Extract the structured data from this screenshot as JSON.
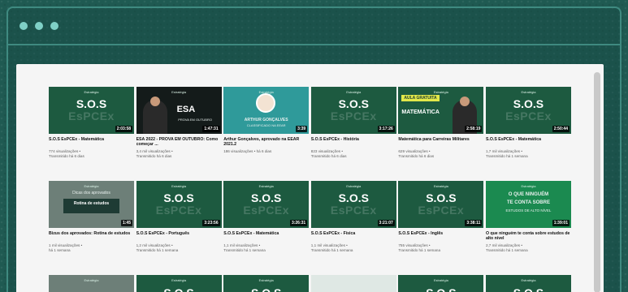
{
  "colors": {
    "background": "#1f5a52",
    "frame": "#3f8a80",
    "panel": "#f5f5f5",
    "thumb_green": "#1d5a40"
  },
  "videos": [
    {
      "style": "sos",
      "brand": "Estratégia",
      "sos": "S.O.S",
      "espcex": "EsPCEx",
      "duration": "2:03:58",
      "title": "S.O.S EsPCEx - Matemática",
      "meta1": "774 visualizações •",
      "meta2": "Transmitido há 6 dias"
    },
    {
      "style": "esa",
      "brand": "Estratégia",
      "big": "ESA",
      "sub": "PROVA EM OUTUBRO",
      "duration": "1:47:31",
      "title": "ESA 2022 - PROVA EM OUTUBRO: Como começar ...",
      "meta1": "3,4 mil visualizações •",
      "meta2": "Transmitido há 6 dias"
    },
    {
      "style": "arthur",
      "brand": "Estratégia",
      "sub": "ARTHUR GONÇALVES",
      "sub2": "CLASSIFICADO NA EEAR",
      "duration": "3:39",
      "title": "Arthur Gonçalves, aprovado na EEAR 2021.2",
      "meta1": "186 visualizações • há 6 dias",
      "meta2": ""
    },
    {
      "style": "sos",
      "brand": "Estratégia",
      "sos": "S.O.S",
      "espcex": "EsPCEx",
      "duration": "3:17:26",
      "title": "S.O.S EsPCEx - História",
      "meta1": "823 visualizações •",
      "meta2": "Transmitido há 6 dias"
    },
    {
      "style": "aula",
      "brand": "Estratégia",
      "tag": "AULA",
      "tag2": "GRATUITA",
      "mat": "MATEMÁTICA",
      "duration": "2:58:19",
      "title": "Matemática para Carreiras Militares",
      "meta1": "629 visualizações •",
      "meta2": "Transmitido há 6 dias"
    },
    {
      "style": "sos",
      "brand": "Estratégia",
      "sos": "S.O.S",
      "espcex": "EsPCEx",
      "duration": "2:50:44",
      "title": "S.O.S EsPCEx - Matemática",
      "meta1": "1,7 mil visualizações •",
      "meta2": "Transmitido há 1 semana"
    },
    {
      "style": "bizus",
      "brand": "Estratégia",
      "sub": "Dicas dos aprovados",
      "box": "Rotina de estudos",
      "duration": "1:45",
      "title": "Bizus dos aprovados: Rotina de estudos",
      "meta1": "1 mil visualizações •",
      "meta2": "há 1 semana"
    },
    {
      "style": "sos",
      "brand": "Estratégia",
      "sos": "S.O.S",
      "espcex": "EsPCEx",
      "duration": "3:23:56",
      "title": "S.O.S EsPCEx - Português",
      "meta1": "1,2 mil visualizações •",
      "meta2": "Transmitido há 1 semana"
    },
    {
      "style": "sos",
      "brand": "Estratégia",
      "sos": "S.O.S",
      "espcex": "EsPCEx",
      "duration": "3:26:31",
      "title": "S.O.S EsPCEx - Matemática",
      "meta1": "1,1 mil visualizações •",
      "meta2": "Transmitido há 1 semana"
    },
    {
      "style": "sos",
      "brand": "Estratégia",
      "sos": "S.O.S",
      "espcex": "EsPCEx",
      "duration": "3:21:07",
      "title": "S.O.S EsPCEx - Física",
      "meta1": "1,1 mil visualizações •",
      "meta2": "Transmitido há 1 semana"
    },
    {
      "style": "sos",
      "brand": "Estratégia",
      "sos": "S.O.S",
      "espcex": "EsPCEx",
      "duration": "3:38:11",
      "title": "S.O.S EsPCEx - Inglês",
      "meta1": "755 visualizações •",
      "meta2": "Transmitido há 1 semana"
    },
    {
      "style": "oque",
      "brand": "Estratégia",
      "sub": "O QUE NINGUÉM",
      "sub2": "TE CONTA SOBRE",
      "sub3": "ESTUDOS DE ALTO NÍVEL",
      "duration": "1:39:01",
      "title": "O que ninguém te conta sobre estudos de alto nível",
      "meta1": "2,7 mil visualizações •",
      "meta2": "Transmitido há 1 semana"
    }
  ],
  "row3": [
    {
      "style": "gray",
      "brand": "Estratégia",
      "sos": ""
    },
    {
      "style": "sos",
      "brand": "Estratégia",
      "sos": "S.O.S"
    },
    {
      "style": "sos",
      "brand": "Estratégia",
      "sos": "S.O.S"
    },
    {
      "style": "light",
      "brand": "",
      "sos": ""
    },
    {
      "style": "sos",
      "brand": "Estratégia",
      "sos": "S.O.S"
    },
    {
      "style": "sos",
      "brand": "Estratégia",
      "sos": "S.O.S"
    }
  ]
}
